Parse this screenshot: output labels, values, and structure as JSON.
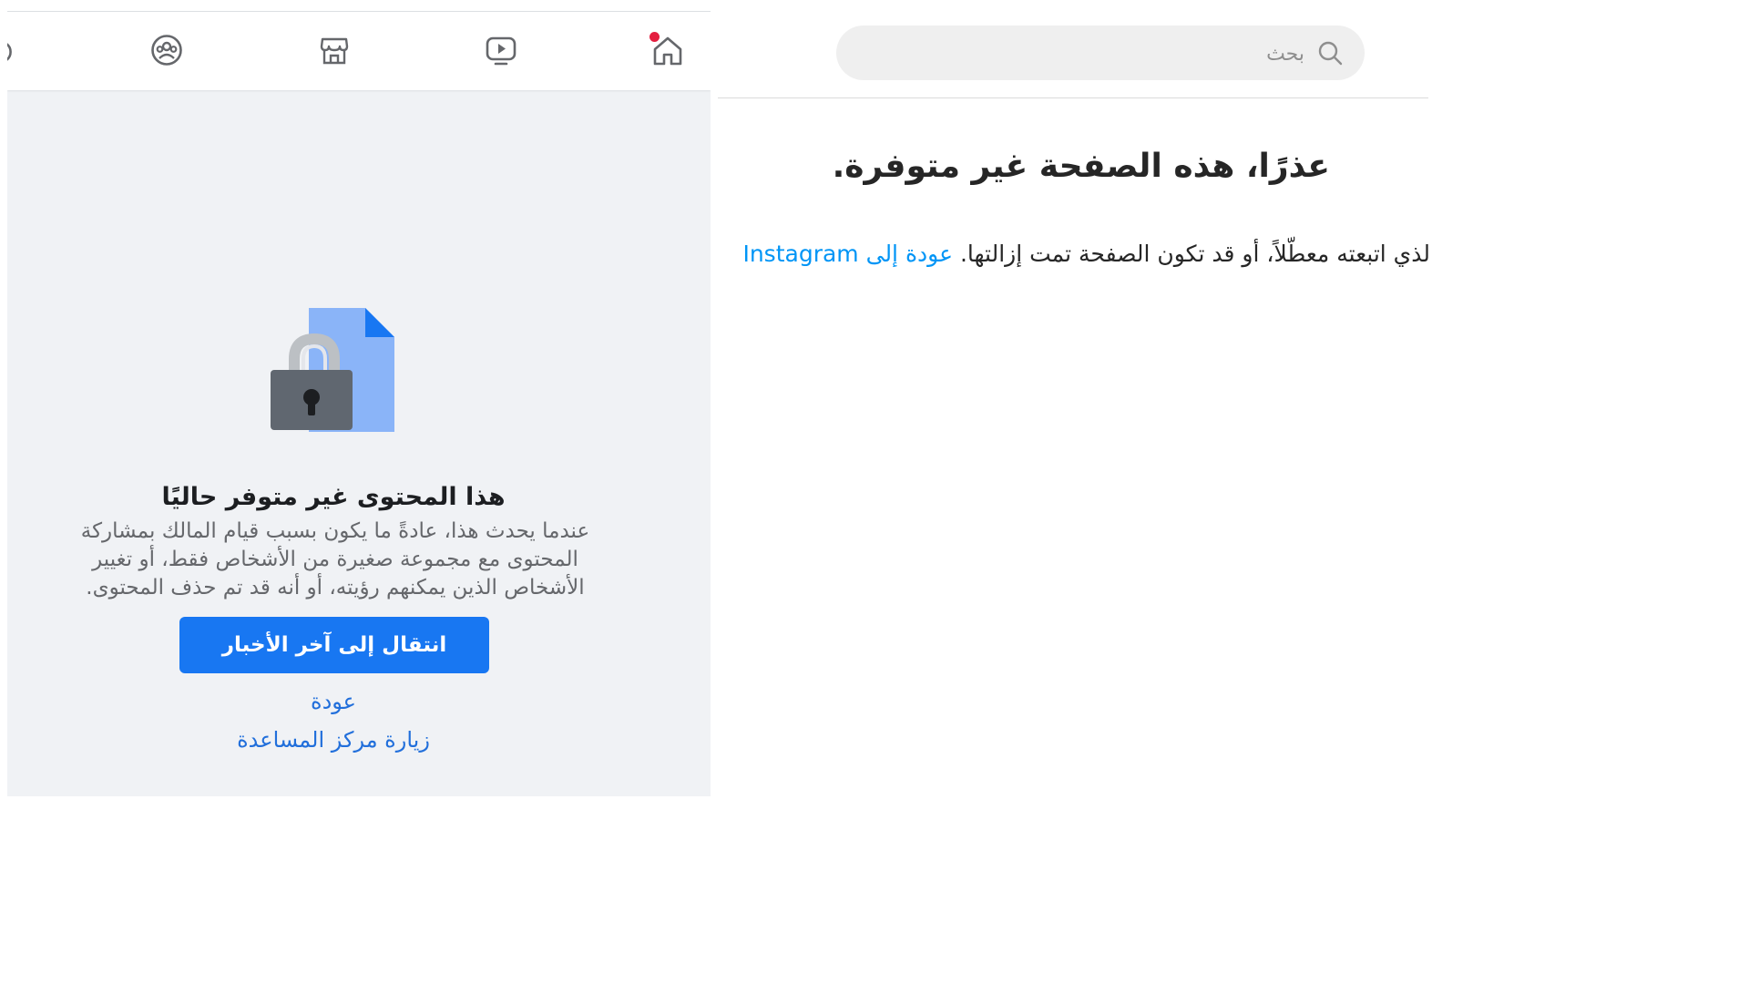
{
  "facebook": {
    "nav": {
      "items": [
        {
          "icon": "home-icon"
        },
        {
          "icon": "watch-icon"
        },
        {
          "icon": "marketplace-icon"
        },
        {
          "icon": "groups-icon"
        },
        {
          "icon": "gaming-icon"
        }
      ]
    },
    "content": {
      "illustration": "lock-document-icon",
      "title": "هذا المحتوى غير متوفر حاليًا",
      "description": "عندما يحدث هذا، عادةً ما يكون بسبب قيام المالك بمشاركة المحتوى مع مجموعة صغيرة من الأشخاص فقط، أو تغيير الأشخاص الذين يمكنهم رؤيته، أو أنه قد تم حذف المحتوى.",
      "primary_button": "انتقال إلى آخر الأخبار",
      "back_link": "عودة",
      "help_link": "زيارة مركز المساعدة"
    },
    "colors": {
      "primary": "#1877f2",
      "link": "#216fdb",
      "notification": "#e41e3f"
    }
  },
  "instagram": {
    "search": {
      "placeholder": "بحث",
      "icon": "search-icon"
    },
    "title": "عذرًا، هذه الصفحة غير متوفرة.",
    "message_text": "ط الذي اتبعته معطّلاً، أو قد تكون الصفحة تمت إزالتها. ",
    "back_link": "عودة إلى Instagram",
    "colors": {
      "link": "#0095f6"
    }
  }
}
